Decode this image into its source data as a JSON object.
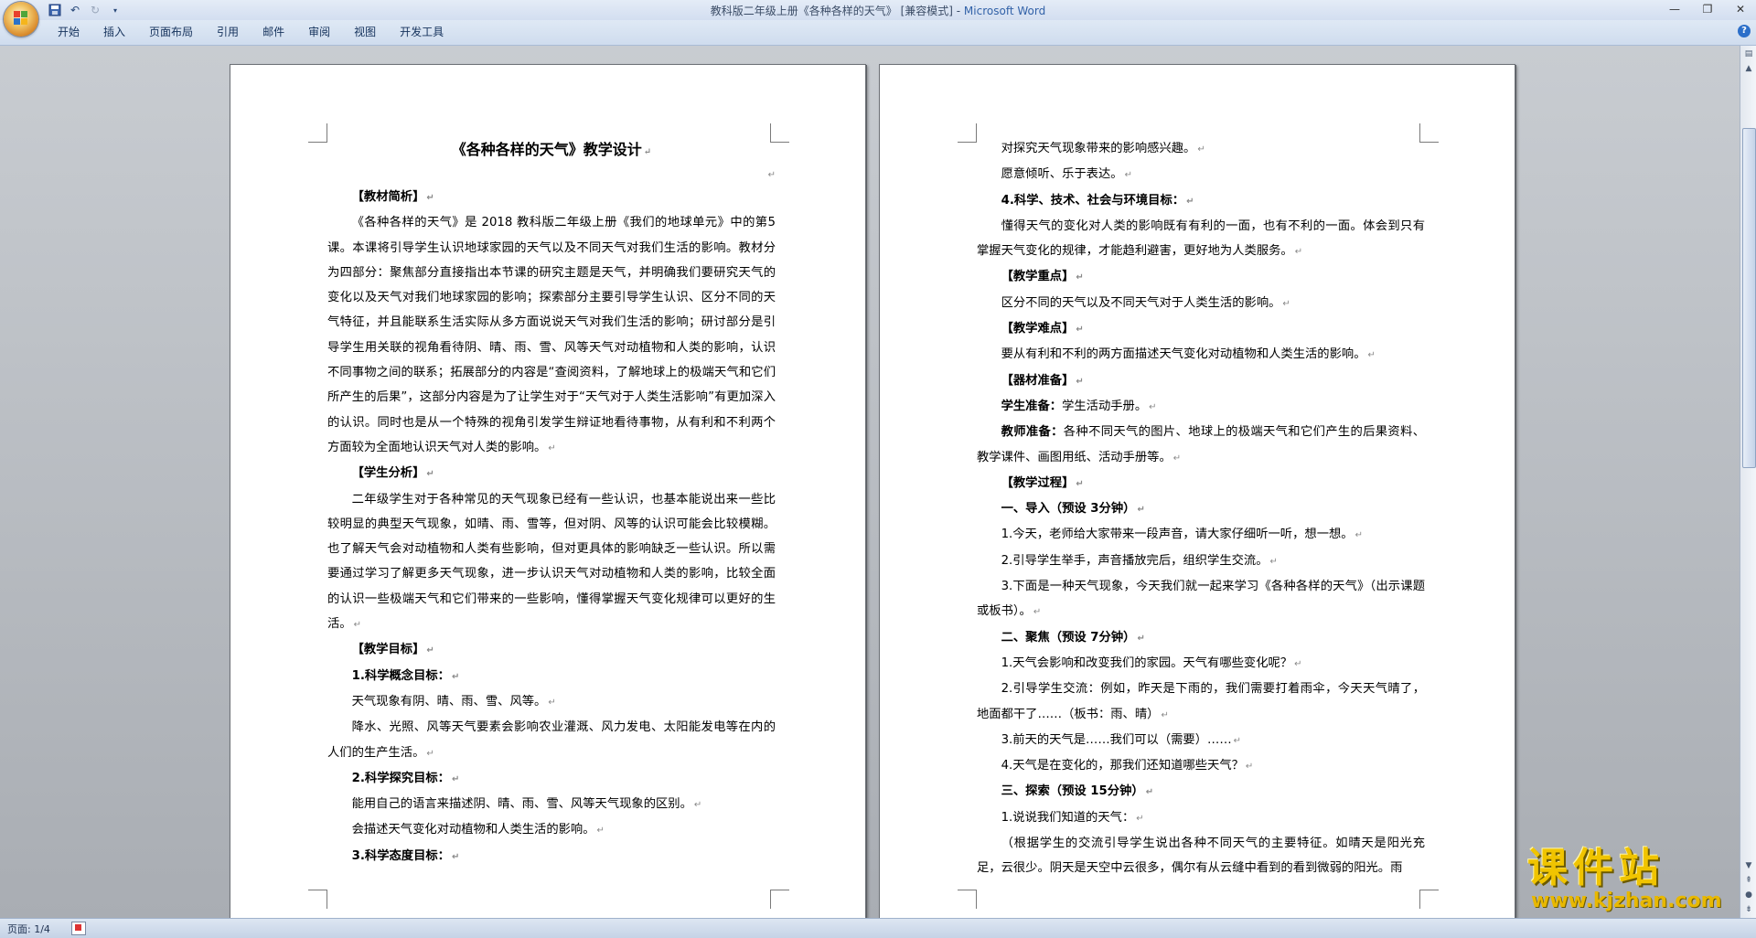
{
  "window": {
    "title_doc": "教科版二年级上册《各种各样的天气》 [兼容模式] - ",
    "title_app": "Microsoft Word"
  },
  "quick_access": {
    "save_icon": "save-icon",
    "undo_icon": "undo-icon",
    "redo_icon": "redo-icon"
  },
  "ribbon": {
    "tabs": [
      "开始",
      "插入",
      "页面布局",
      "引用",
      "邮件",
      "审阅",
      "视图",
      "开发工具"
    ]
  },
  "page1": {
    "title": "《各种各样的天气》教学设计",
    "lines": [
      {
        "text": "【教材简析】",
        "bold": true,
        "indent": true
      },
      {
        "text": "《各种各样的天气》是 2018 教科版二年级上册《我们的地球单元》中的第5课。本课将引导学生认识地球家园的天气以及不同天气对我们生活的影响。教材分为四部分：聚焦部分直接指出本节课的研究主题是天气，并明确我们要研究天气的变化以及天气对我们地球家园的影响；探索部分主要引导学生认识、区分不同的天气特征，并且能联系生活实际从多方面说说天气对我们生活的影响；研讨部分是引导学生用关联的视角看待阴、晴、雨、雪、风等天气对动植物和人类的影响，认识不同事物之间的联系；拓展部分的内容是“查阅资料，了解地球上的极端天气和它们所产生的后果”，这部分内容是为了让学生对于“天气对于人类生活影响”有更加深入的认识。同时也是从一个特殊的视角引发学生辩证地看待事物，从有利和不利两个方面较为全面地认识天气对人类的影响。",
        "bold": false,
        "indent": true
      },
      {
        "text": "【学生分析】",
        "bold": true,
        "indent": true
      },
      {
        "text": "二年级学生对于各种常见的天气现象已经有一些认识，也基本能说出来一些比较明显的典型天气现象，如晴、雨、雪等，但对阴、风等的认识可能会比较模糊。也了解天气会对动植物和人类有些影响，但对更具体的影响缺乏一些认识。所以需要通过学习了解更多天气现象，进一步认识天气对动植物和人类的影响，比较全面的认识一些极端天气和它们带来的一些影响，懂得掌握天气变化规律可以更好的生活。",
        "bold": false,
        "indent": true
      },
      {
        "text": "【教学目标】",
        "bold": true,
        "indent": true
      },
      {
        "text": "1.科学概念目标：",
        "bold": true,
        "indent": true
      },
      {
        "text": "天气现象有阴、晴、雨、雪、风等。",
        "bold": false,
        "indent": true
      },
      {
        "text": "降水、光照、风等天气要素会影响农业灌溉、风力发电、太阳能发电等在内的人们的生产生活。",
        "bold": false,
        "indent": true
      },
      {
        "text": "2.科学探究目标：",
        "bold": true,
        "indent": true
      },
      {
        "text": "能用自己的语言来描述阴、晴、雨、雪、风等天气现象的区别。",
        "bold": false,
        "indent": true
      },
      {
        "text": "会描述天气变化对动植物和人类生活的影响。",
        "bold": false,
        "indent": true
      },
      {
        "text": "3.科学态度目标：",
        "bold": true,
        "indent": true
      }
    ]
  },
  "page2": {
    "lines": [
      {
        "text": "对探究天气现象带来的影响感兴趣。",
        "bold": false,
        "indent": true
      },
      {
        "text": "愿意倾听、乐于表达。",
        "bold": false,
        "indent": true
      },
      {
        "text": "4.科学、技术、社会与环境目标：",
        "bold": true,
        "indent": true
      },
      {
        "text": "懂得天气的变化对人类的影响既有有利的一面，也有不利的一面。体会到只有掌握天气变化的规律，才能趋利避害，更好地为人类服务。",
        "bold": false,
        "indent": true
      },
      {
        "text": "【教学重点】",
        "bold": true,
        "indent": true
      },
      {
        "text": "区分不同的天气以及不同天气对于人类生活的影响。",
        "bold": false,
        "indent": true
      },
      {
        "text": "【教学难点】",
        "bold": true,
        "indent": true
      },
      {
        "text": "要从有利和不利的两方面描述天气变化对动植物和人类生活的影响。",
        "bold": false,
        "indent": true
      },
      {
        "text": "【器材准备】",
        "bold": true,
        "indent": true
      },
      {
        "text": "学生准备：学生活动手册。",
        "bold": false,
        "indent": true,
        "label": "学生准备："
      },
      {
        "text": "教师准备：各种不同天气的图片、地球上的极端天气和它们产生的后果资料、教学课件、画图用纸、活动手册等。",
        "bold": false,
        "indent": true,
        "label": "教师准备："
      },
      {
        "text": "【教学过程】",
        "bold": true,
        "indent": true
      },
      {
        "text": "一、导入（预设 3分钟）",
        "bold": true,
        "indent": true
      },
      {
        "text": "1.今天，老师给大家带来一段声音，请大家仔细听一听，想一想。",
        "bold": false,
        "indent": true
      },
      {
        "text": "2.引导学生举手，声音播放完后，组织学生交流。",
        "bold": false,
        "indent": true
      },
      {
        "text": "3.下面是一种天气现象，今天我们就一起来学习《各种各样的天气》（出示课题或板书）。",
        "bold": false,
        "indent": true
      },
      {
        "text": "二、聚焦（预设 7分钟）",
        "bold": true,
        "indent": true
      },
      {
        "text": "1.天气会影响和改变我们的家园。天气有哪些变化呢？",
        "bold": false,
        "indent": true
      },
      {
        "text": "2.引导学生交流：例如，昨天是下雨的，我们需要打着雨伞，今天天气晴了，地面都干了……（板书：雨、晴）",
        "bold": false,
        "indent": true
      },
      {
        "text": "3.前天的天气是……我们可以（需要）……",
        "bold": false,
        "indent": true
      },
      {
        "text": "4.天气是在变化的，那我们还知道哪些天气？",
        "bold": false,
        "indent": true
      },
      {
        "text": "三、探索（预设 15分钟）",
        "bold": true,
        "indent": true
      },
      {
        "text": "1.说说我们知道的天气：",
        "bold": false,
        "indent": true
      },
      {
        "text": "（根据学生的交流引导学生说出各种不同天气的主要特征。如晴天是阳光充足，云很少。阴天是天空中云很多，偶尔有从云缝中看到的看到微弱的阳光。雨",
        "bold": false,
        "indent": true,
        "nomark": true
      }
    ]
  },
  "status": {
    "page": "页面: 1/4"
  },
  "watermark": {
    "cn": "课件站",
    "url": "www.kjzhan.com"
  }
}
